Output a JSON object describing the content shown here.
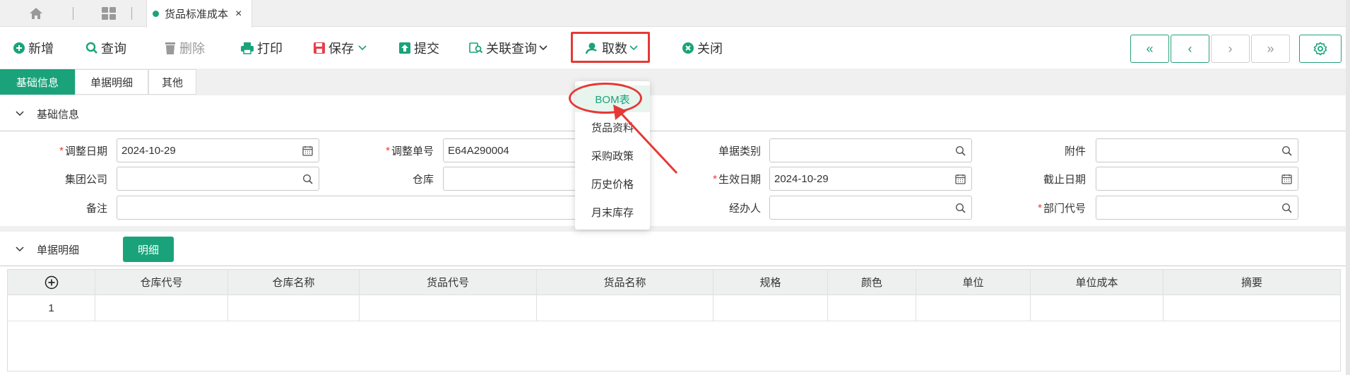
{
  "tabbar": {
    "active_tab": "货品标准成本",
    "close_glyph": "×"
  },
  "toolbar": {
    "new": "新增",
    "query": "查询",
    "delete": "删除",
    "print": "打印",
    "save": "保存",
    "submit": "提交",
    "linked_query": "关联查询",
    "fetch": "取数",
    "close": "关闭",
    "nav": [
      "«",
      "‹",
      "›",
      "»"
    ]
  },
  "subtabs": [
    "基础信息",
    "单据明细",
    "其他"
  ],
  "section_basic": {
    "title": "基础信息"
  },
  "form": {
    "adjust_date": {
      "label": "调整日期",
      "value": "2024-10-29"
    },
    "adjust_no": {
      "label": "调整单号",
      "value": "E64A290004"
    },
    "doc_type": {
      "label": "单据类别",
      "value": ""
    },
    "attachment": {
      "label": "附件",
      "value": ""
    },
    "group_company": {
      "label": "集团公司",
      "value": ""
    },
    "warehouse": {
      "label": "仓库",
      "value": ""
    },
    "effective_date": {
      "label": "生效日期",
      "value": "2024-10-29"
    },
    "end_date": {
      "label": "截止日期",
      "value": ""
    },
    "remark": {
      "label": "备注",
      "value": ""
    },
    "handler": {
      "label": "经办人",
      "value": ""
    },
    "dept_code": {
      "label": "部门代号",
      "value": ""
    },
    "required_mark": "*"
  },
  "section_detail": {
    "title": "单据明细",
    "button": "明细"
  },
  "table": {
    "columns": [
      "仓库代号",
      "仓库名称",
      "货品代号",
      "货品名称",
      "规格",
      "颜色",
      "单位",
      "单位成本",
      "摘要"
    ],
    "rows": [
      {
        "no": "1",
        "cells": [
          "",
          "",
          "",
          "",
          "",
          "",
          "",
          "",
          ""
        ]
      }
    ]
  },
  "dropdown": {
    "items": [
      "BOM表",
      "货品资料",
      "采购政策",
      "历史价格",
      "月末库存"
    ]
  },
  "colors": {
    "accent": "#1aa37a",
    "annotation": "#e53935"
  }
}
